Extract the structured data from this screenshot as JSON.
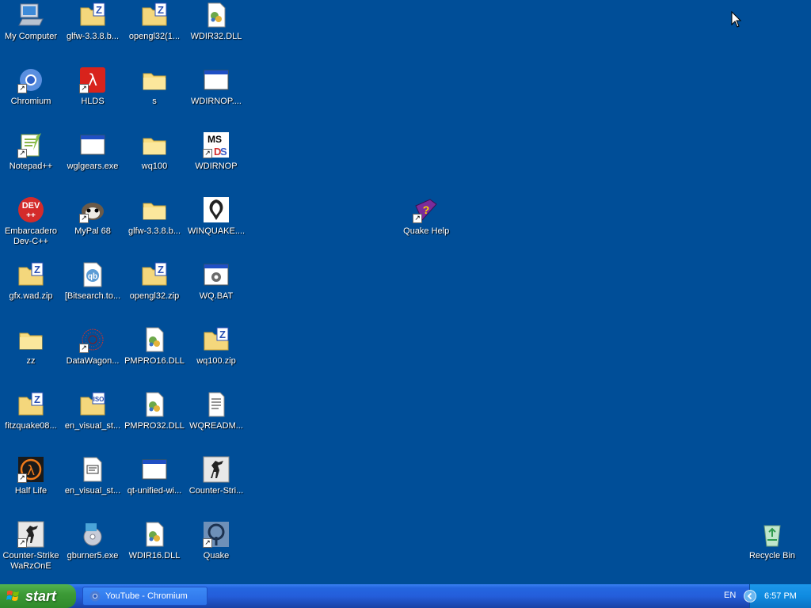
{
  "desktop": {
    "icons": [
      {
        "label": "My Computer",
        "kind": "computer",
        "shortcut": false
      },
      {
        "label": "glfw-3.3.8.b...",
        "kind": "zip",
        "shortcut": false
      },
      {
        "label": "opengl32(1...",
        "kind": "zip",
        "shortcut": false
      },
      {
        "label": "WDIR32.DLL",
        "kind": "dll",
        "shortcut": false
      },
      {
        "label": "Chromium",
        "kind": "chromium",
        "shortcut": true
      },
      {
        "label": "HLDS",
        "kind": "hlds",
        "shortcut": true
      },
      {
        "label": "s",
        "kind": "folder",
        "shortcut": false
      },
      {
        "label": "WDIRNOP....",
        "kind": "window",
        "shortcut": false
      },
      {
        "label": "Notepad++",
        "kind": "notepadpp",
        "shortcut": true
      },
      {
        "label": "wglgears.exe",
        "kind": "window",
        "shortcut": false
      },
      {
        "label": "wq100",
        "kind": "folder",
        "shortcut": false
      },
      {
        "label": "WDIRNOP",
        "kind": "msdos",
        "shortcut": true
      },
      {
        "label": "Embarcadero Dev-C++",
        "kind": "devcpp",
        "shortcut": false
      },
      {
        "label": "MyPal 68",
        "kind": "mypal",
        "shortcut": true
      },
      {
        "label": "glfw-3.3.8.b...",
        "kind": "folder",
        "shortcut": false
      },
      {
        "label": "WINQUAKE....",
        "kind": "quake-white",
        "shortcut": false
      },
      {
        "label": "Quake Help",
        "kind": "help",
        "shortcut": true
      },
      {
        "label": "gfx.wad.zip",
        "kind": "zip",
        "shortcut": false
      },
      {
        "label": "[Bitsearch.to...",
        "kind": "qbit",
        "shortcut": false
      },
      {
        "label": "opengl32.zip",
        "kind": "zip",
        "shortcut": false
      },
      {
        "label": "WQ.BAT",
        "kind": "bat",
        "shortcut": false
      },
      {
        "label": "zz",
        "kind": "folder",
        "shortcut": false
      },
      {
        "label": "DataWagon...",
        "kind": "datawagon",
        "shortcut": true
      },
      {
        "label": "PMPRO16.DLL",
        "kind": "dll",
        "shortcut": false
      },
      {
        "label": "wq100.zip",
        "kind": "zip",
        "shortcut": false
      },
      {
        "label": "fitzquake08...",
        "kind": "zip",
        "shortcut": false
      },
      {
        "label": "en_visual_st...",
        "kind": "iso",
        "shortcut": false
      },
      {
        "label": "PMPRO32.DLL",
        "kind": "dll",
        "shortcut": false
      },
      {
        "label": "WQREADM...",
        "kind": "text",
        "shortcut": false
      },
      {
        "label": "Half Life",
        "kind": "halflife",
        "shortcut": true
      },
      {
        "label": "en_visual_st...",
        "kind": "ini",
        "shortcut": false
      },
      {
        "label": "qt-unified-wi...",
        "kind": "window",
        "shortcut": false
      },
      {
        "label": "Counter-Stri...",
        "kind": "cs",
        "shortcut": false
      },
      {
        "label": "Counter-Strike WaRzOnE",
        "kind": "cs",
        "shortcut": true
      },
      {
        "label": "gburner5.exe",
        "kind": "gburner",
        "shortcut": false
      },
      {
        "label": "WDIR16.DLL",
        "kind": "dll",
        "shortcut": false
      },
      {
        "label": "Quake",
        "kind": "quake-blue",
        "shortcut": true
      },
      {
        "label": "Recycle Bin",
        "kind": "recycle",
        "shortcut": false
      }
    ]
  },
  "taskbar": {
    "start_label": "start",
    "task_label": "YouTube - Chromium",
    "language": "EN",
    "clock": "6:57 PM"
  }
}
